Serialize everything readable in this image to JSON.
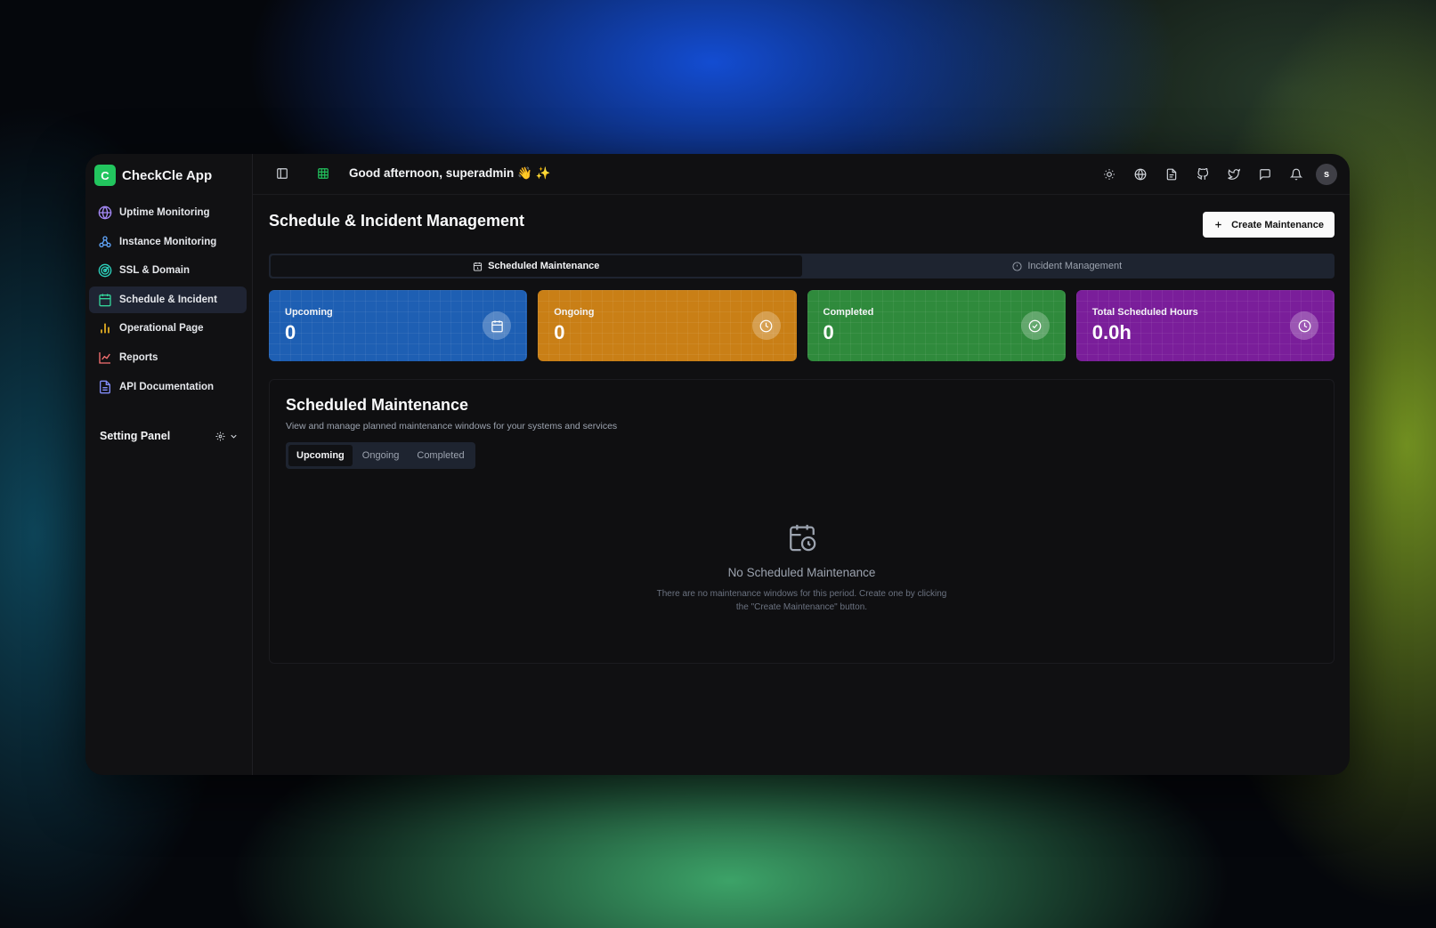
{
  "app": {
    "logo_letter": "C",
    "name": "CheckCle App"
  },
  "sidebar": {
    "items": [
      {
        "label": "Uptime Monitoring",
        "icon": "globe-icon"
      },
      {
        "label": "Instance Monitoring",
        "icon": "network-icon"
      },
      {
        "label": "SSL & Domain",
        "icon": "radar-icon"
      },
      {
        "label": "Schedule & Incident",
        "icon": "calendar-icon",
        "active": true
      },
      {
        "label": "Operational Page",
        "icon": "bar-chart-icon"
      },
      {
        "label": "Reports",
        "icon": "line-chart-icon"
      },
      {
        "label": "API Documentation",
        "icon": "document-icon"
      }
    ],
    "setting_panel": "Setting Panel"
  },
  "topbar": {
    "greeting": "Good afternoon, superadmin 👋 ✨",
    "avatar_letter": "s",
    "icons": [
      "sun-icon",
      "globe-icon",
      "document-icon",
      "github-icon",
      "twitter-icon",
      "chat-icon",
      "bell-icon"
    ]
  },
  "page": {
    "title": "Schedule & Incident Management",
    "create_button": "Create Maintenance",
    "tabs": [
      {
        "label": "Scheduled Maintenance",
        "active": true
      },
      {
        "label": "Incident Management",
        "active": false
      }
    ]
  },
  "cards": [
    {
      "label": "Upcoming",
      "value": "0",
      "color": "#1e5fb3",
      "icon": "calendar-icon"
    },
    {
      "label": "Ongoing",
      "value": "0",
      "color": "#c97f16",
      "icon": "clock-icon"
    },
    {
      "label": "Completed",
      "value": "0",
      "color": "#2f8a3c",
      "icon": "check-circle-icon"
    },
    {
      "label": "Total Scheduled Hours",
      "value": "0.0h",
      "color": "#7a1e9a",
      "icon": "clock-icon"
    }
  ],
  "panel": {
    "title": "Scheduled Maintenance",
    "subtitle": "View and manage planned maintenance windows for your systems and services",
    "tabs": [
      "Upcoming",
      "Ongoing",
      "Completed"
    ],
    "active_tab": "Upcoming",
    "empty_title": "No Scheduled Maintenance",
    "empty_desc": "There are no maintenance windows for this period. Create one by clicking the \"Create Maintenance\" button."
  }
}
